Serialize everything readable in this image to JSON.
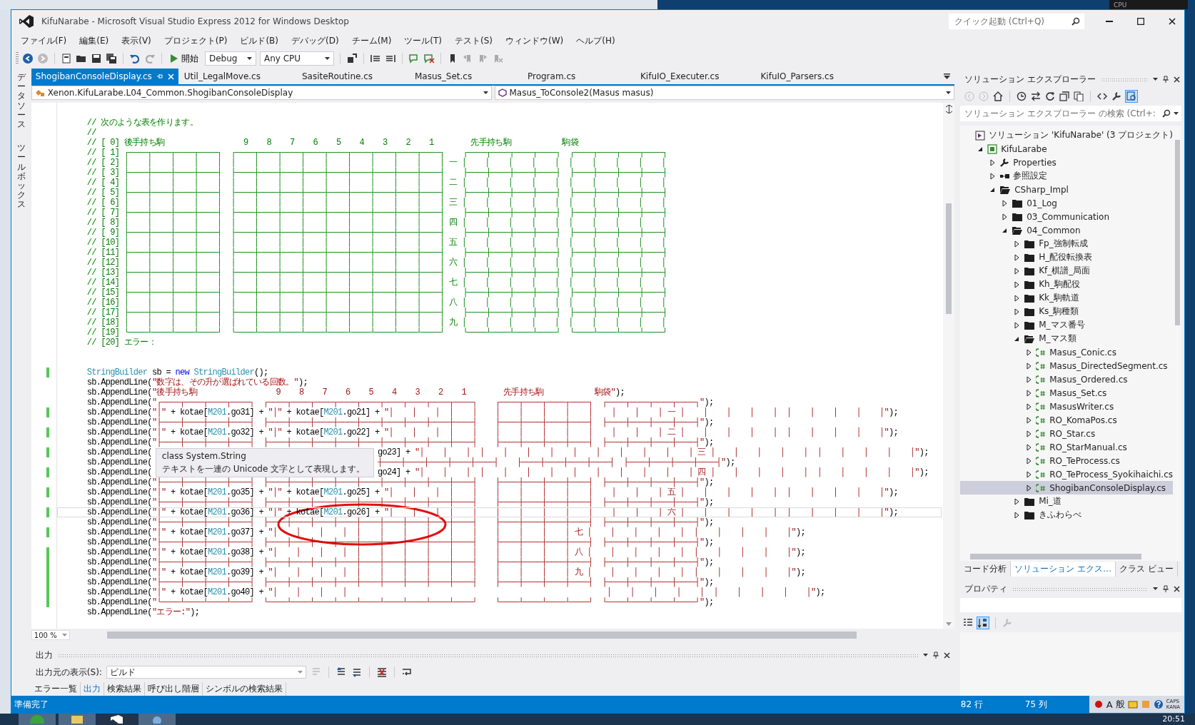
{
  "window": {
    "title": "KifuNarabe - Microsoft Visual Studio Express 2012 for Windows Desktop"
  },
  "desktop": {
    "gadget_label": "CPU"
  },
  "quick_launch": {
    "placeholder": "クイック起動 (Ctrl+Q)"
  },
  "menu": [
    "ファイル(F)",
    "編集(E)",
    "表示(V)",
    "プロジェクト(P)",
    "ビルド(B)",
    "デバッグ(D)",
    "チーム(M)",
    "ツール(T)",
    "テスト(S)",
    "ウィンドウ(W)",
    "ヘルプ(H)"
  ],
  "toolbar": {
    "start_label": "開始",
    "configuration": "Debug",
    "platform": "Any CPU"
  },
  "side_tabs": [
    {
      "label": "データソース"
    },
    {
      "label": "ツールボックス"
    }
  ],
  "editor_tabs": [
    {
      "label": "ShogibanConsoleDisplay.cs",
      "selected": true
    },
    {
      "label": "Util_LegalMove.cs",
      "selected": false
    },
    {
      "label": "SasiteRoutine.cs",
      "selected": false
    },
    {
      "label": "Masus_Set.cs",
      "selected": false
    },
    {
      "label": "Program.cs",
      "selected": false
    },
    {
      "label": "KifuIO_Executer.cs",
      "selected": false
    },
    {
      "label": "KifuIO_Parsers.cs",
      "selected": false
    }
  ],
  "nav_bar": {
    "type": "Xenon.KifuLarabe.L04_Common.ShogibanConsoleDisplay",
    "member": "Masus_ToConsole2(Masus masus)"
  },
  "code": {
    "lines": [
      {
        "kind": "code",
        "changed": false,
        "current": false,
        "tokens": [
          {
            "text": "// 次のような表を作ります。",
            "kind": "comment"
          }
        ]
      },
      {
        "kind": "code",
        "changed": false,
        "current": false,
        "tokens": [
          {
            "text": "//",
            "kind": "comment"
          }
        ]
      },
      {
        "kind": "code",
        "changed": false,
        "current": false,
        "tokens": [
          {
            "text": "// [ 0] 後手持ち駒                 9    8    7    6    5    4    3    2    1        先手持ち駒           駒袋",
            "kind": "comment"
          }
        ]
      },
      {
        "kind": "code",
        "changed": false,
        "current": false,
        "tokens": [
          {
            "text": "// [ 1] ┌────┬────┬────┬────┐  ┌────┬────┬────┬────┬────┬────┬────┬────┬────┐    ┌────┬────┬────┬────┐  ┌────┬────┬────┬────┐",
            "kind": "comment"
          }
        ]
      },
      {
        "kind": "code",
        "changed": false,
        "current": false,
        "tokens": [
          {
            "text": "// [ 2] │    │    │    │    │  │    │    │    │    │    │    │    │    │    │ 一 │    │    │    │    │  │    │    │    │    │",
            "kind": "comment"
          }
        ]
      },
      {
        "kind": "code",
        "changed": false,
        "current": false,
        "tokens": [
          {
            "text": "// [ 3] ├────┼────┼────┼────┤  ├────┼────┼────┼────┼────┼────┼────┼────┼────┤    ├────┼────┼────┼────┤  ├────┼────┼────┼────┤",
            "kind": "comment"
          }
        ]
      },
      {
        "kind": "code",
        "changed": false,
        "current": false,
        "tokens": [
          {
            "text": "// [ 4] │    │    │    │    │  │    │    │    │    │    │    │    │    │    │ 二 │    │    │    │    │  │    │    │    │    │",
            "kind": "comment"
          }
        ]
      },
      {
        "kind": "code",
        "changed": false,
        "current": false,
        "tokens": [
          {
            "text": "// [ 5] ├────┼────┼────┼────┤  ├────┼────┼────┼────┼────┼────┼────┼────┼────┤    ├────┼────┼────┼────┤  ├────┼────┼────┼────┤",
            "kind": "comment"
          }
        ]
      },
      {
        "kind": "code",
        "changed": false,
        "current": false,
        "tokens": [
          {
            "text": "// [ 6] │    │    │    │    │  │    │    │    │    │    │    │    │    │    │ 三 │    │    │    │    │  │    │    │    │    │",
            "kind": "comment"
          }
        ]
      },
      {
        "kind": "code",
        "changed": false,
        "current": false,
        "tokens": [
          {
            "text": "// [ 7] ├────┼────┼────┼────┤  ├────┼────┼────┼────┼────┼────┼────┼────┼────┤    ├────┼────┼────┼────┤  ├────┼────┼────┼────┤",
            "kind": "comment"
          }
        ]
      },
      {
        "kind": "code",
        "changed": false,
        "current": false,
        "tokens": [
          {
            "text": "// [ 8] │    │    │    │    │  │    │    │    │    │    │    │    │    │    │ 四 │    │    │    │    │  │    │    │    │    │",
            "kind": "comment"
          }
        ]
      },
      {
        "kind": "code",
        "changed": false,
        "current": false,
        "tokens": [
          {
            "text": "// [ 9] ├────┼────┼────┼────┤  ├────┼────┼────┼────┼────┼────┼────┼────┼────┤    ├────┼────┼────┼────┤  ├────┼────┼────┼────┤",
            "kind": "comment"
          }
        ]
      },
      {
        "kind": "code",
        "changed": false,
        "current": false,
        "tokens": [
          {
            "text": "// [10] │    │    │    │    │  │    │    │    │    │    │    │    │    │    │ 五 │    │    │    │    │  │    │    │    │    │",
            "kind": "comment"
          }
        ]
      },
      {
        "kind": "code",
        "changed": false,
        "current": false,
        "tokens": [
          {
            "text": "// [11] ├────┼────┼────┼────┤  ├────┼────┼────┼────┼────┼────┼────┼────┼────┤    ├────┼────┼────┼────┤  ├────┼────┼────┼────┤",
            "kind": "comment"
          }
        ]
      },
      {
        "kind": "code",
        "changed": false,
        "current": false,
        "tokens": [
          {
            "text": "// [12] │    │    │    │    │  │    │    │    │    │    │    │    │    │    │ 六 │    │    │    │    │  │    │    │    │    │",
            "kind": "comment"
          }
        ]
      },
      {
        "kind": "code",
        "changed": false,
        "current": false,
        "tokens": [
          {
            "text": "// [13] ├────┼────┼────┼────┤  ├────┼────┼────┼────┼────┼────┼────┼────┼────┤    ├────┼────┼────┼────┤  ├────┼────┼────┼────┤",
            "kind": "comment"
          }
        ]
      },
      {
        "kind": "code",
        "changed": false,
        "current": false,
        "tokens": [
          {
            "text": "// [14] │    │    │    │    │  │    │    │    │    │    │    │    │    │    │ 七 │    │    │    │    │  │    │    │    │    │",
            "kind": "comment"
          }
        ]
      },
      {
        "kind": "code",
        "changed": false,
        "current": false,
        "tokens": [
          {
            "text": "// [15] ├────┼────┼────┼────┤  ├────┼────┼────┼────┼────┼────┼────┼────┼────┤    ├────┼────┼────┼────┤  ├────┼────┼────┼────┤",
            "kind": "comment"
          }
        ]
      },
      {
        "kind": "code",
        "changed": false,
        "current": false,
        "tokens": [
          {
            "text": "// [16] │    │    │    │    │  │    │    │    │    │    │    │    │    │    │ 八 │    │    │    │    │  │    │    │    │    │",
            "kind": "comment"
          }
        ]
      },
      {
        "kind": "code",
        "changed": false,
        "current": false,
        "tokens": [
          {
            "text": "// [17] ├────┼────┼────┼────┤  ├────┼────┼────┼────┼────┼────┼────┼────┼────┤    ├────┼────┼────┼────┤  ├────┼────┼────┼────┤",
            "kind": "comment"
          }
        ]
      },
      {
        "kind": "code",
        "changed": false,
        "current": false,
        "tokens": [
          {
            "text": "// [18] │    │    │    │    │  │    │    │    │    │    │    │    │    │    │ 九 │    │    │    │    │  │    │    │    │    │",
            "kind": "comment"
          }
        ]
      },
      {
        "kind": "code",
        "changed": false,
        "current": false,
        "tokens": [
          {
            "text": "// [19] └────┴────┴────┴────┘  └────┴────┴────┴────┴────┴────┴────┴────┴────┘    └────┴────┴────┴────┘  └────┴────┴────┴────┘",
            "kind": "comment"
          }
        ]
      },
      {
        "kind": "code",
        "changed": false,
        "current": false,
        "tokens": [
          {
            "text": "// [20] エラー：",
            "kind": "comment"
          }
        ]
      },
      {
        "kind": "blank",
        "changed": false,
        "current": false
      },
      {
        "kind": "blank",
        "changed": false,
        "current": false
      },
      {
        "kind": "code",
        "changed": true,
        "current": false,
        "tokens": [
          {
            "text": "StringBuilder",
            "kind": "type"
          },
          {
            "text": " sb = ",
            "kind": "plain"
          },
          {
            "text": "new",
            "kind": "keyword"
          },
          {
            "text": " StringBuilder",
            "kind": "type"
          },
          {
            "text": "();",
            "kind": "plain"
          }
        ]
      },
      {
        "kind": "code",
        "changed": false,
        "current": false,
        "tokens": [
          {
            "text": "sb.AppendLine(",
            "kind": "plain"
          },
          {
            "text": "\"数字は、その升が選ばれている回数。\"",
            "kind": "string"
          },
          {
            "text": ");",
            "kind": "plain"
          }
        ]
      },
      {
        "kind": "code",
        "changed": false,
        "current": false,
        "tokens": [
          {
            "text": "sb.AppendLine(",
            "kind": "plain"
          },
          {
            "text": "\"後手持ち駒                 9    8    7    6    5    4    3    2    1        先手持ち駒           駒袋\"",
            "kind": "string"
          },
          {
            "text": ");",
            "kind": "plain"
          }
        ]
      },
      {
        "kind": "code",
        "changed": false,
        "current": false,
        "tokens": [
          {
            "text": "sb.AppendLine(",
            "kind": "plain"
          },
          {
            "text": "\"┌────┬────┬────┬────┐  ┌────┬────┬────┬────┬────┬────┬────┬────┬────┐    ┌────┬────┬────┬────┐  ┌────┬────┬────┬────┐\"",
            "kind": "string"
          },
          {
            "text": ");",
            "kind": "plain"
          }
        ]
      },
      {
        "kind": "code",
        "changed": true,
        "current": false,
        "tokens": [
          {
            "text": "sb.AppendLine(",
            "kind": "plain"
          },
          {
            "text": "\"│\"",
            "kind": "string"
          },
          {
            "text": " + kotae[",
            "kind": "plain"
          },
          {
            "text": "M201",
            "kind": "field"
          },
          {
            "text": ".go31] + ",
            "kind": "plain"
          },
          {
            "text": "\"│\"",
            "kind": "string"
          },
          {
            "text": " + kotae[",
            "kind": "plain"
          },
          {
            "text": "M201",
            "kind": "field"
          },
          {
            "text": ".go21] + ",
            "kind": "plain"
          },
          {
            "text": "\"│    │    │  │    │    │    │    │    │    │    │    │    │ 一 │    │    │    │    │  │    │    │    │    │\"",
            "kind": "string"
          },
          {
            "text": ");",
            "kind": "plain"
          }
        ]
      },
      {
        "kind": "code",
        "changed": false,
        "current": false,
        "tokens": [
          {
            "text": "sb.AppendLine(",
            "kind": "plain"
          },
          {
            "text": "\"├────┼────┼────┼────┤  ├────┼────┼────┼────┼────┼────┼────┼────┼────┤    ├────┼────┼────┼────┤  ├────┼────┼────┼────┤\"",
            "kind": "string"
          },
          {
            "text": ");",
            "kind": "plain"
          }
        ]
      },
      {
        "kind": "code",
        "changed": true,
        "current": false,
        "tokens": [
          {
            "text": "sb.AppendLine(",
            "kind": "plain"
          },
          {
            "text": "\"│\"",
            "kind": "string"
          },
          {
            "text": " + kotae[",
            "kind": "plain"
          },
          {
            "text": "M201",
            "kind": "field"
          },
          {
            "text": ".go32] + ",
            "kind": "plain"
          },
          {
            "text": "\"│\"",
            "kind": "string"
          },
          {
            "text": " + kotae[",
            "kind": "plain"
          },
          {
            "text": "M201",
            "kind": "field"
          },
          {
            "text": ".go22] + ",
            "kind": "plain"
          },
          {
            "text": "\"│    │    │  │    │    │    │    │    │    │    │    │    │ 二 │    │    │    │    │  │    │    │    │    │\"",
            "kind": "string"
          },
          {
            "text": ");",
            "kind": "plain"
          }
        ]
      },
      {
        "kind": "code",
        "changed": false,
        "current": false,
        "tokens": [
          {
            "text": "sb.AppendLine(",
            "kind": "plain"
          },
          {
            "text": "\"├────┼────┼────┼────┤  ├────┼────┼────┼────┼────┼────┼────┼────┼────┤    ├────┼────┼────┼────┤  ├────┼────┼────┼────┤\"",
            "kind": "string"
          },
          {
            "text": ");",
            "kind": "plain"
          }
        ]
      },
      {
        "kind": "covered",
        "changed": true,
        "current": false,
        "tokens": [
          {
            "text": "sb.AppendLine(",
            "kind": "plain"
          },
          {
            "text": "go23] + ",
            "kind": "plain"
          },
          {
            "text": "\"│    │    │  │    │    │    │    │    │    │    │    │    │ 三 │    │    │    │    │  │    │    │    │    │\"",
            "kind": "string"
          },
          {
            "text": ");",
            "kind": "plain"
          }
        ]
      },
      {
        "kind": "covered",
        "changed": false,
        "current": false,
        "tokens": [
          {
            "text": "sb.AppendLine(",
            "kind": "plain"
          },
          {
            "text": "┼────┼────┼────┼────┼────┤    ├────┼────┼────┼────┤  ├────┼────┼────┼────┤\"",
            "kind": "string"
          },
          {
            "text": ");",
            "kind": "plain"
          }
        ]
      },
      {
        "kind": "covered",
        "changed": true,
        "current": false,
        "tokens": [
          {
            "text": "sb.AppendLine(",
            "kind": "plain"
          },
          {
            "text": "go24] + ",
            "kind": "plain"
          },
          {
            "text": "\"│    │    │  │    │    │    │    │    │    │    │    │    │ 四 │    │    │    │    │  │    │    │    │    │\"",
            "kind": "string"
          },
          {
            "text": ");",
            "kind": "plain"
          }
        ]
      },
      {
        "kind": "code",
        "changed": false,
        "current": false,
        "tokens": [
          {
            "text": "sb.AppendLine(",
            "kind": "plain"
          },
          {
            "text": "\"├────┼────┼────┼────┤  ├────┼────┼────┼────┼────┼────┼────┼────┼────┤    ├────┼────┼────┼────┤  ├────┼────┼────┼────┤\"",
            "kind": "string"
          },
          {
            "text": ");",
            "kind": "plain"
          }
        ]
      },
      {
        "kind": "code",
        "changed": true,
        "current": false,
        "tokens": [
          {
            "text": "sb.AppendLine(",
            "kind": "plain"
          },
          {
            "text": "\"│\"",
            "kind": "string"
          },
          {
            "text": " + kotae[",
            "kind": "plain"
          },
          {
            "text": "M201",
            "kind": "field"
          },
          {
            "text": ".go35] + ",
            "kind": "plain"
          },
          {
            "text": "\"│\"",
            "kind": "string"
          },
          {
            "text": " + kotae[",
            "kind": "plain"
          },
          {
            "text": "M201",
            "kind": "field"
          },
          {
            "text": ".go25] + ",
            "kind": "plain"
          },
          {
            "text": "\"│    │    │  │    │    │    │    │    │    │    │    │    │ 五 │    │    │    │    │  │    │    │    │    │\"",
            "kind": "string"
          },
          {
            "text": ");",
            "kind": "plain"
          }
        ]
      },
      {
        "kind": "code",
        "changed": false,
        "current": false,
        "tokens": [
          {
            "text": "sb.AppendLine(",
            "kind": "plain"
          },
          {
            "text": "\"├────┼────┼────┼────┤  ├────┼────┼────┼────┼────┼────┼────┼────┼────┤    ├────┼────┼────┼────┤  ├────┼────┼────┼────┤\"",
            "kind": "string"
          },
          {
            "text": ");",
            "kind": "plain"
          }
        ]
      },
      {
        "kind": "code",
        "changed": true,
        "current": true,
        "tokens": [
          {
            "text": "sb.AppendLine(",
            "kind": "plain"
          },
          {
            "text": "\"│\"",
            "kind": "string"
          },
          {
            "text": " + kotae[",
            "kind": "plain"
          },
          {
            "text": "M201",
            "kind": "field"
          },
          {
            "text": ".go36] + ",
            "kind": "plain"
          },
          {
            "text": "\"│\"",
            "kind": "string"
          },
          {
            "text": " + kotae[",
            "kind": "plain"
          },
          {
            "text": "M201",
            "kind": "field"
          },
          {
            "text": ".go26] + ",
            "kind": "plain"
          },
          {
            "text": "\"│    │    │  │    │    │    │    │    │    │    │    │    │ 六 │    │    │    │    │  │    │    │    │    │\"",
            "kind": "string"
          },
          {
            "text": ");",
            "kind": "plain"
          }
        ]
      },
      {
        "kind": "code",
        "changed": false,
        "current": false,
        "tokens": [
          {
            "text": "sb.AppendLine(",
            "kind": "plain"
          },
          {
            "text": "\"├────┼────┼────┼────┤  ├────┼────┼────┼────┼────┼────┼────┼────┼────┤    ├────┼────┼────┼────┤  ├────┼────┼────┼────┤\"",
            "kind": "string"
          },
          {
            "text": ");",
            "kind": "plain"
          }
        ]
      },
      {
        "kind": "code",
        "changed": true,
        "current": false,
        "tokens": [
          {
            "text": "sb.AppendLine(",
            "kind": "plain"
          },
          {
            "text": "\"│\"",
            "kind": "string"
          },
          {
            "text": " + kotae[",
            "kind": "plain"
          },
          {
            "text": "M201",
            "kind": "field"
          },
          {
            "text": ".go37] + ",
            "kind": "plain"
          },
          {
            "text": "\"│    │    │    │  │    │    │    │    │    │    │    │    │    │ 七 │    │    │    │    │  │    │    │    │    │\"",
            "kind": "string"
          },
          {
            "text": ");",
            "kind": "plain"
          }
        ]
      },
      {
        "kind": "code",
        "changed": false,
        "current": false,
        "tokens": [
          {
            "text": "sb.AppendLine(",
            "kind": "plain"
          },
          {
            "text": "\"├────┼────┼────┼────┤  ├────┼────┼────┼────┼────┼────┼────┼────┼────┤    ├────┼────┼────┼────┤  ├────┼────┼────┼────┤\"",
            "kind": "string"
          },
          {
            "text": ");",
            "kind": "plain"
          }
        ]
      },
      {
        "kind": "code",
        "changed": true,
        "current": false,
        "tokens": [
          {
            "text": "sb.AppendLine(",
            "kind": "plain"
          },
          {
            "text": "\"│\"",
            "kind": "string"
          },
          {
            "text": " + kotae[",
            "kind": "plain"
          },
          {
            "text": "M201",
            "kind": "field"
          },
          {
            "text": ".go38] + ",
            "kind": "plain"
          },
          {
            "text": "\"│    │    │    │  │    │    │    │    │    │    │    │    │    │ 八 │    │    │    │    │  │    │    │    │    │\"",
            "kind": "string"
          },
          {
            "text": ");",
            "kind": "plain"
          }
        ]
      },
      {
        "kind": "code",
        "changed": true,
        "current": false,
        "tokens": [
          {
            "text": "sb.AppendLine(",
            "kind": "plain"
          },
          {
            "text": "\"├────┼────┼────┼────┤  ├────┼────┼────┼────┼────┼────┼────┼────┼────┤    ├────┼────┼────┼────┤  ├────┼────┼────┼────┤\"",
            "kind": "string"
          },
          {
            "text": ");",
            "kind": "plain"
          }
        ]
      },
      {
        "kind": "code",
        "changed": true,
        "current": false,
        "tokens": [
          {
            "text": "sb.AppendLine(",
            "kind": "plain"
          },
          {
            "text": "\"│\"",
            "kind": "string"
          },
          {
            "text": " + kotae[",
            "kind": "plain"
          },
          {
            "text": "M201",
            "kind": "field"
          },
          {
            "text": ".go39] + ",
            "kind": "plain"
          },
          {
            "text": "\"│    │    │    │  │    │    │    │    │    │    │    │    │    │ 九 │    │    │    │    │  │    │    │    │    │\"",
            "kind": "string"
          },
          {
            "text": ");",
            "kind": "plain"
          }
        ]
      },
      {
        "kind": "code",
        "changed": true,
        "current": false,
        "tokens": [
          {
            "text": "sb.AppendLine(",
            "kind": "plain"
          },
          {
            "text": "\"├────┼────┼────┼────┤  ├────┼────┼────┼────┼────┼────┼────┼────┼────┤    ├────┼────┼────┼────┤  ├────┼────┼────┼────┤\"",
            "kind": "string"
          },
          {
            "text": ");",
            "kind": "plain"
          }
        ]
      },
      {
        "kind": "code",
        "changed": true,
        "current": false,
        "tokens": [
          {
            "text": "sb.AppendLine(",
            "kind": "plain"
          },
          {
            "text": "\"│\"",
            "kind": "string"
          },
          {
            "text": " + kotae[",
            "kind": "plain"
          },
          {
            "text": "M201",
            "kind": "field"
          },
          {
            "text": ".go40] + ",
            "kind": "plain"
          },
          {
            "text": "\"│    │    │    │                                                        │    │    │    │    │  │    │    │    │    │\"",
            "kind": "string"
          },
          {
            "text": ");",
            "kind": "plain"
          }
        ]
      },
      {
        "kind": "code",
        "changed": true,
        "current": false,
        "tokens": [
          {
            "text": "sb.AppendLine(",
            "kind": "plain"
          },
          {
            "text": "\"└────┴────┴────┴────┘  └────┴────┴────┴────┴────┴────┴────┴────┴────┘    └────┴────┴────┴────┘  └────┴────┴────┴────┘\"",
            "kind": "string"
          },
          {
            "text": ");",
            "kind": "plain"
          }
        ]
      },
      {
        "kind": "code",
        "changed": false,
        "current": false,
        "tokens": [
          {
            "text": "sb.AppendLine(",
            "kind": "plain"
          },
          {
            "text": "\"エラー:\"",
            "kind": "string"
          },
          {
            "text": ");",
            "kind": "plain"
          }
        ]
      }
    ],
    "tooltip": {
      "title": "class System.String",
      "text": "テキストを一連の Unicode 文字として表現します。"
    }
  },
  "zoom": "100 %",
  "output": {
    "title": "出力",
    "source_label": "出力元の表示(S):",
    "source": "ビルド",
    "tabs": [
      {
        "label": "エラー一覧",
        "selected": false
      },
      {
        "label": "出力",
        "selected": true
      },
      {
        "label": "検索結果",
        "selected": false
      },
      {
        "label": "呼び出し階層",
        "selected": false
      },
      {
        "label": "シンボルの検索結果",
        "selected": false
      }
    ]
  },
  "solution_explorer": {
    "title": "ソリューション エクスプローラー",
    "search_placeholder": "ソリューション エクスプローラー の検索 (Ctrl+:",
    "tree": [
      {
        "label": "ソリューション 'KifuNarabe' (3 プロジェクト)",
        "kind": "solution",
        "selected": false,
        "children": [
          {
            "label": "KifuLarabe",
            "kind": "project",
            "expanded": true,
            "selected": false,
            "children": [
              {
                "label": "Properties",
                "kind": "properties",
                "expanded": false,
                "selected": false
              },
              {
                "label": "参照設定",
                "kind": "references",
                "expanded": false,
                "selected": false
              },
              {
                "label": "CSharp_Impl",
                "kind": "folder",
                "expanded": true,
                "selected": false,
                "children": [
                  {
                    "label": "01_Log",
                    "kind": "folder",
                    "expanded": false,
                    "selected": false
                  },
                  {
                    "label": "03_Communication",
                    "kind": "folder",
                    "expanded": false,
                    "selected": false
                  },
                  {
                    "label": "04_Common",
                    "kind": "folder",
                    "expanded": true,
                    "selected": false,
                    "children": [
                      {
                        "label": "Fp_強制転成",
                        "kind": "folder",
                        "expanded": false,
                        "selected": false
                      },
                      {
                        "label": "H_配役転換表",
                        "kind": "folder",
                        "expanded": false,
                        "selected": false
                      },
                      {
                        "label": "Kf_棋譜_局面",
                        "kind": "folder",
                        "expanded": false,
                        "selected": false
                      },
                      {
                        "label": "Kh_駒配役",
                        "kind": "folder",
                        "expanded": false,
                        "selected": false
                      },
                      {
                        "label": "Kk_駒軌道",
                        "kind": "folder",
                        "expanded": false,
                        "selected": false
                      },
                      {
                        "label": "Ks_駒種類",
                        "kind": "folder",
                        "expanded": false,
                        "selected": false
                      },
                      {
                        "label": "M_マス番号",
                        "kind": "folder",
                        "expanded": false,
                        "selected": false
                      },
                      {
                        "label": "M_マス類",
                        "kind": "folder",
                        "expanded": true,
                        "selected": false,
                        "children": [
                          {
                            "label": "Masus_Conic.cs",
                            "kind": "file",
                            "expanded": false,
                            "selected": false
                          },
                          {
                            "label": "Masus_DirectedSegment.cs",
                            "kind": "file",
                            "expanded": false,
                            "selected": false
                          },
                          {
                            "label": "Masus_Ordered.cs",
                            "kind": "file",
                            "expanded": false,
                            "selected": false
                          },
                          {
                            "label": "Masus_Set.cs",
                            "kind": "file",
                            "expanded": false,
                            "selected": false
                          },
                          {
                            "label": "MasusWriter.cs",
                            "kind": "file",
                            "expanded": false,
                            "selected": false
                          },
                          {
                            "label": "RO_KomaPos.cs",
                            "kind": "file",
                            "expanded": false,
                            "selected": false
                          },
                          {
                            "label": "RO_Star.cs",
                            "kind": "file",
                            "expanded": false,
                            "selected": false
                          },
                          {
                            "label": "RO_StarManual.cs",
                            "kind": "file",
                            "expanded": false,
                            "selected": false
                          },
                          {
                            "label": "RO_TeProcess.cs",
                            "kind": "file",
                            "expanded": false,
                            "selected": false
                          },
                          {
                            "label": "RO_TeProcess_Syokihaichi.cs",
                            "kind": "file",
                            "expanded": false,
                            "selected": false
                          },
                          {
                            "label": "ShogibanConsoleDisplay.cs",
                            "kind": "file",
                            "expanded": false,
                            "selected": true
                          }
                        ]
                      },
                      {
                        "label": "Mi_道",
                        "kind": "folder",
                        "expanded": false,
                        "selected": false
                      },
                      {
                        "label": "きふわらべ",
                        "kind": "folder",
                        "expanded": false,
                        "selected": false
                      }
                    ]
                  }
                ]
              }
            ]
          }
        ]
      }
    ],
    "tabs": [
      {
        "label": "コード分析",
        "selected": false
      },
      {
        "label": "ソリューション エクス…",
        "selected": true
      },
      {
        "label": "クラス ビュー",
        "selected": false
      }
    ]
  },
  "properties": {
    "title": "プロパティ"
  },
  "status_bar": {
    "message": "準備完了",
    "line": "82 行",
    "column": "75 列",
    "ime_mode": "A",
    "ime_input": "般",
    "caps": "CAPS",
    "kana": "KANA"
  },
  "taskbar": {
    "clock": "20:51"
  }
}
